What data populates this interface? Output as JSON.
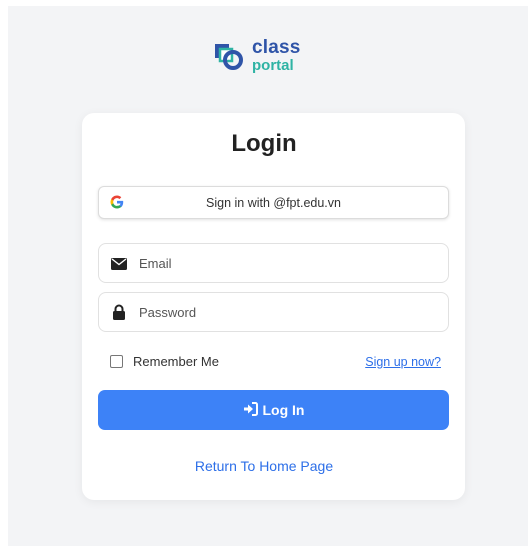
{
  "logo": {
    "line1": "class",
    "line2": "portal"
  },
  "login_card": {
    "title": "Login",
    "google_button_label": "Sign in with @fpt.edu.vn",
    "email_placeholder": "Email",
    "password_placeholder": "Password",
    "remember_label": "Remember Me",
    "remember_checked": false,
    "signup_link": "Sign up now?",
    "login_button_label": "Log In",
    "home_link": "Return To Home Page"
  },
  "colors": {
    "primary": "#3d82f7",
    "link": "#2d6fe8",
    "logo_blue": "#2f54a8",
    "logo_teal": "#2fb3a4",
    "page_background": "#f3f4f6"
  },
  "icons": {
    "google": "google-g-icon",
    "email": "envelope-icon",
    "password": "lock-icon",
    "login": "sign-in-arrow-icon"
  }
}
